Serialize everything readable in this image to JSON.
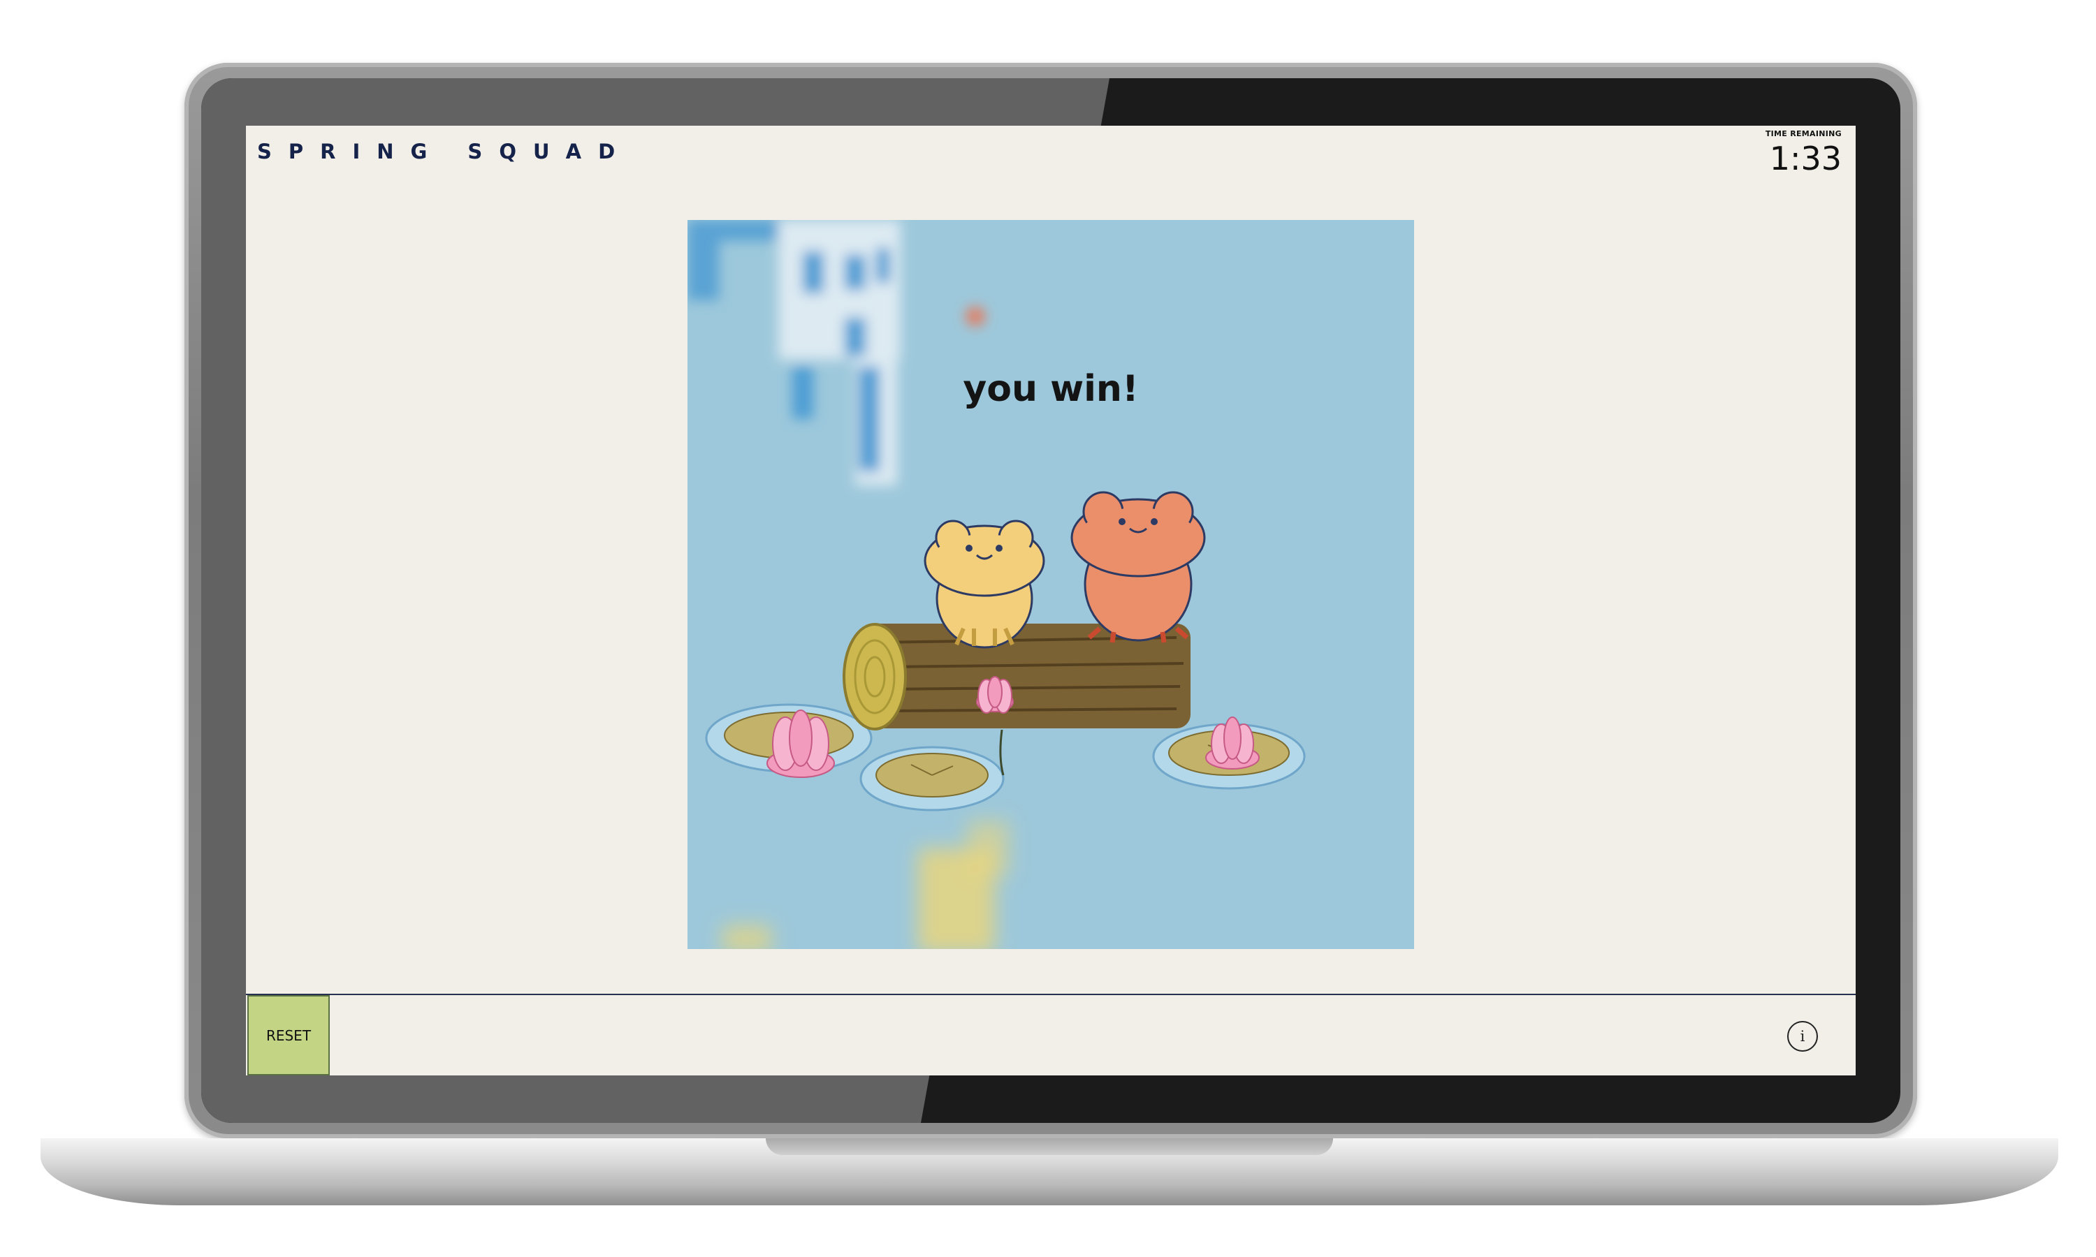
{
  "app": {
    "title": "SPRING SQUAD"
  },
  "timer": {
    "label": "TIME REMAINING",
    "value": "1:33"
  },
  "board": {
    "message": "you win!",
    "artwork": [
      "yellow-frog",
      "orange-frog",
      "log",
      "lily-pads",
      "lotus-flowers"
    ]
  },
  "footer": {
    "reset_label": "RESET",
    "info_label": "i",
    "info_icon": "info-circle-icon"
  },
  "colors": {
    "screen_background": "#f2efe8",
    "brand_text": "#15234a",
    "board_water": "#9dc8db",
    "reset_button": "#c3d585",
    "yellow_frog": "#f3cf7c",
    "orange_frog": "#ea8f6a",
    "lotus": "#f29bbd"
  }
}
